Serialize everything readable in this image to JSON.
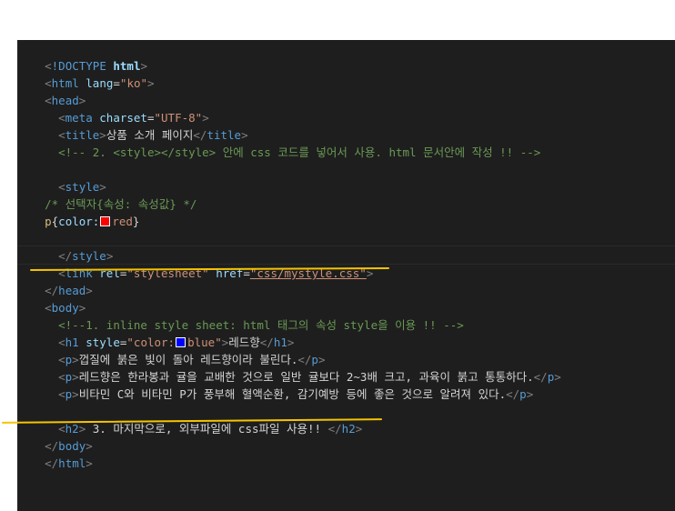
{
  "editor": {
    "lines": [
      {
        "lt": "<",
        "pre": "!DOCTYPE ",
        "tag": "html",
        "gt": ">"
      },
      {
        "tag": "html",
        "attr": "lang",
        "eq": "=",
        "val": "\"ko\""
      },
      {
        "tag": "head"
      },
      {
        "tag": "meta",
        "attr": "charset",
        "eq": "=",
        "val": "\"UTF-8\""
      },
      {
        "tag": "title",
        "text": "상품 소개 페이지",
        "close": "title"
      },
      {
        "comment": "<!-- 2. <style></style> 안에 css 코드를 넣어서 사용. html 문서안에 작성 !! -->"
      },
      {},
      {
        "tag": "style"
      },
      {
        "comment": "/* 선택자{속성: 속성값} */"
      },
      {
        "selector": "p",
        "brace_open": "{",
        "property": "color:",
        "value": "red",
        "brace_close": "}",
        "swatch": "#ff0000"
      },
      {},
      {
        "close_tag": "style"
      },
      {
        "tag": "link",
        "attr1": "rel",
        "val1": "\"stylesheet\"",
        "attr2": "href",
        "val2": "\"css/mystyle.css\""
      },
      {
        "close_tag": "head"
      },
      {
        "tag": "body"
      },
      {
        "comment": "<!--1. inline style sheet: html 태그의 속성 style을 이용 !! -->"
      },
      {
        "tag": "h1",
        "attr": "style",
        "val_pre": "\"color:",
        "val_post": "blue\"",
        "text": "레드향",
        "close": "h1",
        "swatch": "#0000ff"
      },
      {
        "tag": "p",
        "text": "껍질에 붉은 빛이 돌아 레드향이라 불린다.",
        "close": "p"
      },
      {
        "tag": "p",
        "text": "레드향은 한라봉과 귤을 교배한 것으로 일반 귤보다 2~3배 크고, 과육이 붉고 통통하다.",
        "close": "p"
      },
      {
        "tag": "p",
        "text": "비타민 C와 비타민 P가 풍부해 혈액순환, 감기예방 등에 좋은 것으로 알려져 있다.",
        "close": "p"
      },
      {},
      {
        "tag": "h2",
        "text": " 3. 마지막으로, 외부파일에 css파일 사용!! ",
        "close": "h2"
      },
      {
        "close_tag": "body"
      },
      {
        "close_tag": "html"
      }
    ]
  },
  "annotations": {
    "underline_color": "#f5c400"
  }
}
